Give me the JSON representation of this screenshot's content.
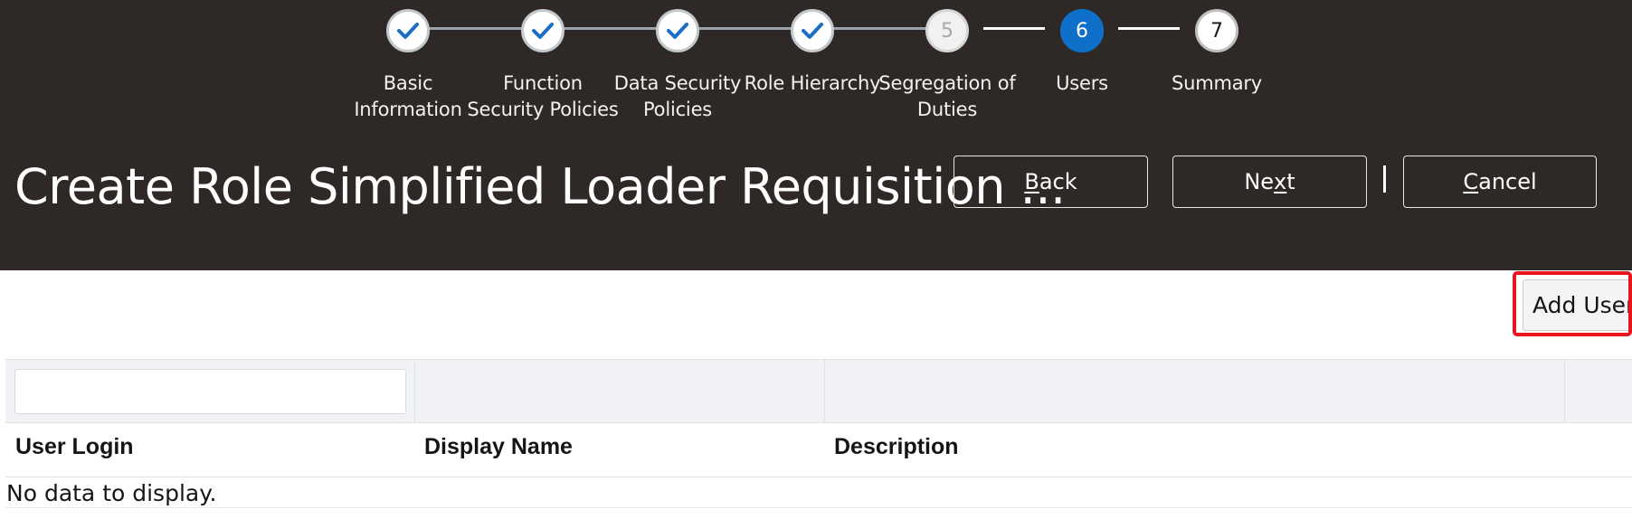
{
  "train": {
    "steps": [
      {
        "label": "Basic Information",
        "state": "visited",
        "marker": ""
      },
      {
        "label": "Function Security Policies",
        "state": "visited",
        "marker": ""
      },
      {
        "label": "Data Security Policies",
        "state": "visited",
        "marker": ""
      },
      {
        "label": "Role Hierarchy",
        "state": "visited",
        "marker": ""
      },
      {
        "label": "Segregation of Duties",
        "state": "unvisited",
        "marker": "5"
      },
      {
        "label": "Users",
        "state": "current",
        "marker": "6"
      },
      {
        "label": "Summary",
        "state": "future",
        "marker": "7"
      }
    ]
  },
  "page": {
    "title": "Create Role Simplified Loader Requisition ..."
  },
  "buttons": {
    "back": {
      "access_key": "B",
      "rest": "ack"
    },
    "next": {
      "before": "Ne",
      "access_key": "x",
      "after": "t"
    },
    "cancel": {
      "access_key": "C",
      "rest": "ancel"
    },
    "add_user": "Add User"
  },
  "table": {
    "filter_value": "",
    "columns": [
      "User Login",
      "Display Name",
      "Description"
    ],
    "empty_message": "No data to display."
  },
  "colors": {
    "header_bg": "#2e2926",
    "current_step": "#0f70c9",
    "highlight": "#e8151c",
    "check": "#1a6fc4"
  },
  "icons": {
    "visited_step": "checkmark-icon"
  }
}
